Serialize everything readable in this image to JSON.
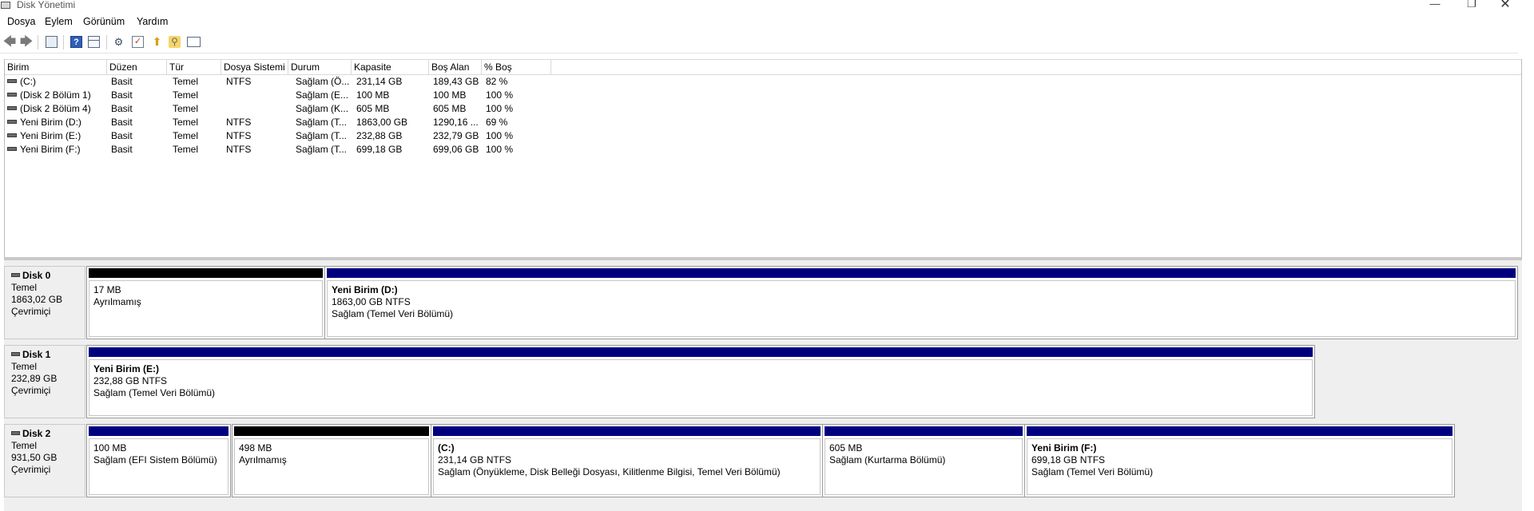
{
  "window": {
    "title": "Disk Yönetimi"
  },
  "menu": [
    {
      "label": "Dosya"
    },
    {
      "label": "Eylem"
    },
    {
      "label": "Görünüm"
    },
    {
      "label": "Yardım"
    }
  ],
  "toolbar": {
    "icons": [
      "back-arrow-icon",
      "forward-arrow-icon",
      "console-tree-icon",
      "help-icon",
      "disk-list-icon",
      "properties-icon",
      "check-icon",
      "up-folder-icon",
      "search-icon",
      "list-view-icon"
    ]
  },
  "volumes": {
    "columns": [
      "Birim",
      "Düzen",
      "Tür",
      "Dosya Sistemi",
      "Durum",
      "Kapasite",
      "Boş Alan",
      "% Boş"
    ],
    "rows": [
      {
        "name": "(C:)",
        "layout": "Basit",
        "type": "Temel",
        "fs": "NTFS",
        "status": "Sağlam (Ö...",
        "capacity": "231,14 GB",
        "free": "189,43 GB",
        "pct": "82 %"
      },
      {
        "name": "(Disk 2 Bölüm 1)",
        "layout": "Basit",
        "type": "Temel",
        "fs": "",
        "status": "Sağlam (E...",
        "capacity": "100 MB",
        "free": "100 MB",
        "pct": "100 %"
      },
      {
        "name": "(Disk 2 Bölüm 4)",
        "layout": "Basit",
        "type": "Temel",
        "fs": "",
        "status": "Sağlam (K...",
        "capacity": "605 MB",
        "free": "605 MB",
        "pct": "100 %"
      },
      {
        "name": "Yeni Birim (D:)",
        "layout": "Basit",
        "type": "Temel",
        "fs": "NTFS",
        "status": "Sağlam (T...",
        "capacity": "1863,00 GB",
        "free": "1290,16 ...",
        "pct": "69 %"
      },
      {
        "name": "Yeni Birim (E:)",
        "layout": "Basit",
        "type": "Temel",
        "fs": "NTFS",
        "status": "Sağlam (T...",
        "capacity": "232,88 GB",
        "free": "232,79 GB",
        "pct": "100 %"
      },
      {
        "name": "Yeni Birim (F:)",
        "layout": "Basit",
        "type": "Temel",
        "fs": "NTFS",
        "status": "Sağlam (T...",
        "capacity": "699,18 GB",
        "free": "699,06 GB",
        "pct": "100 %"
      }
    ]
  },
  "disks": [
    {
      "name": "Disk 0",
      "type": "Temel",
      "size": "1863,02 GB",
      "state": "Çevrimiçi",
      "partitions": [
        {
          "title": "",
          "size": "17 MB",
          "status": "Ayrılmamış",
          "color": "black"
        },
        {
          "title": "Yeni Birim  (D:)",
          "size": "1863,00 GB NTFS",
          "status": "Sağlam (Temel Veri Bölümü)",
          "color": "blue"
        }
      ]
    },
    {
      "name": "Disk 1",
      "type": "Temel",
      "size": "232,89 GB",
      "state": "Çevrimiçi",
      "partitions": [
        {
          "title": "Yeni Birim  (E:)",
          "size": "232,88 GB NTFS",
          "status": "Sağlam (Temel Veri Bölümü)",
          "color": "blue"
        }
      ]
    },
    {
      "name": "Disk 2",
      "type": "Temel",
      "size": "931,50 GB",
      "state": "Çevrimiçi",
      "partitions": [
        {
          "title": "",
          "size": "100 MB",
          "status": "Sağlam (EFI Sistem Bölümü)",
          "color": "blue"
        },
        {
          "title": "",
          "size": "498 MB",
          "status": "Ayrılmamış",
          "color": "black"
        },
        {
          "title": "(C:)",
          "size": "231,14 GB NTFS",
          "status": "Sağlam (Önyükleme, Disk Belleği Dosyası, Kilitlenme Bilgisi, Temel Veri Bölümü)",
          "color": "blue"
        },
        {
          "title": "",
          "size": "605 MB",
          "status": "Sağlam (Kurtarma Bölümü)",
          "color": "blue"
        },
        {
          "title": "Yeni Birim  (F:)",
          "size": "699,18 GB NTFS",
          "status": "Sağlam (Temel Veri Bölümü)",
          "color": "blue"
        }
      ]
    }
  ],
  "colors": {
    "primary_partition": "#00007f",
    "unallocated": "#000000"
  }
}
